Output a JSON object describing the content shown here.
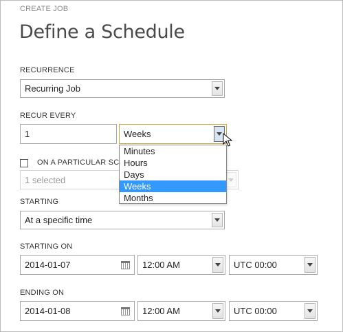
{
  "header": {
    "caption": "CREATE JOB",
    "title": "Define a Schedule"
  },
  "recurrence": {
    "label": "RECURRENCE",
    "value": "Recurring Job"
  },
  "recur_every": {
    "label": "RECUR EVERY",
    "count": "1",
    "unit": "Weeks",
    "options": [
      "Minutes",
      "Hours",
      "Days",
      "Weeks",
      "Months"
    ],
    "selected_option": "Weeks"
  },
  "particular_schedule": {
    "label": "ON A PARTICULAR SCHE",
    "checked": false,
    "placeholder": "1 selected"
  },
  "starting": {
    "label": "STARTING",
    "value": "At a specific time"
  },
  "starting_on": {
    "label": "STARTING ON",
    "date": "2014-01-07",
    "time": "12:00 AM",
    "timezone": "UTC 00:00"
  },
  "ending_on": {
    "label": "ENDING ON",
    "date": "2014-01-08",
    "time": "12:00 AM",
    "timezone": "UTC 00:00"
  },
  "icons": {
    "dropdown": "chevron-down-icon",
    "calendar": "calendar-icon",
    "cursor": "mouse-pointer-icon"
  },
  "colors": {
    "selected_option_bg": "#3399ff",
    "focus_border": "#d6a23a"
  }
}
